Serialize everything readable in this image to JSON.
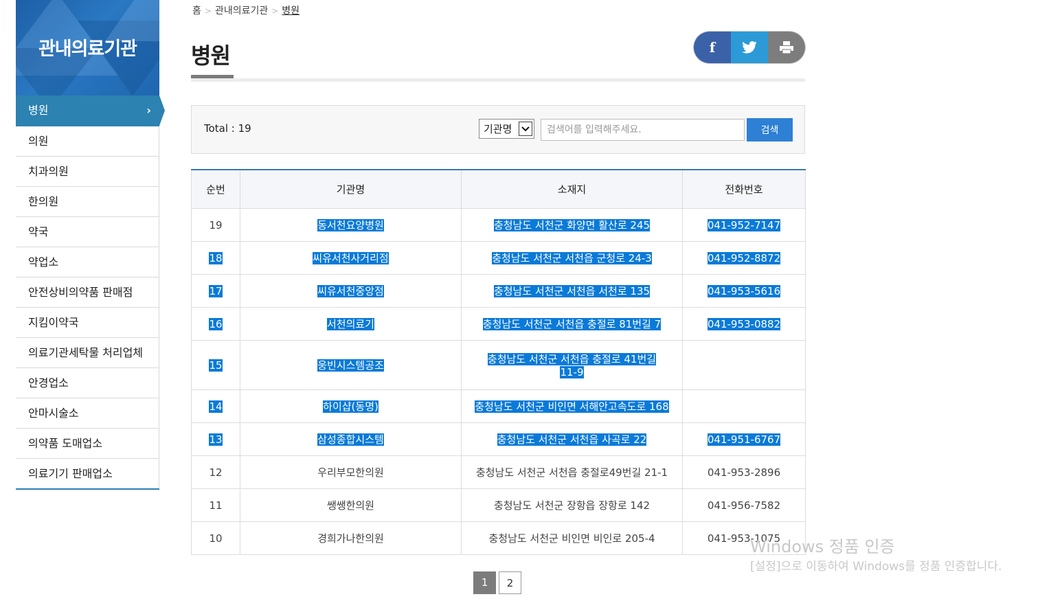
{
  "sidebar": {
    "title": "관내의료기관",
    "items": [
      {
        "label": "병원"
      },
      {
        "label": "의원"
      },
      {
        "label": "치과의원"
      },
      {
        "label": "한의원"
      },
      {
        "label": "약국"
      },
      {
        "label": "약업소"
      },
      {
        "label": "안전상비의약품 판매점"
      },
      {
        "label": "지킴이약국"
      },
      {
        "label": "의료기관세탁물 처리업체"
      },
      {
        "label": "안경업소"
      },
      {
        "label": "안마시술소"
      },
      {
        "label": "의약품 도매업소"
      },
      {
        "label": "의료기기 판매업소"
      }
    ],
    "active_chevron": "›"
  },
  "breadcrumb": {
    "home": "홈",
    "level1": "관내의료기관",
    "current": "병원"
  },
  "page": {
    "title": "병원"
  },
  "share": {
    "facebook": "f"
  },
  "search": {
    "total": "Total : 19",
    "select_value": "기관명",
    "placeholder": "검색어를 입력해주세요.",
    "button": "검색"
  },
  "table": {
    "headers": [
      "순번",
      "기관명",
      "소재지",
      "전화번호"
    ],
    "rows": [
      {
        "no": "19",
        "name": "동서천요양병원",
        "addr": "충청남도 서천군 화양면 활산로 245",
        "addr2": "",
        "tel": "041-952-7147"
      },
      {
        "no": "18",
        "name": "씨유서천사거리점",
        "addr": "충청남도 서천군 서천읍 군청로 24-3",
        "addr2": "",
        "tel": "041-952-8872"
      },
      {
        "no": "17",
        "name": "씨유서천중앙점",
        "addr": "충청남도 서천군 서천읍 서천로 135",
        "addr2": "",
        "tel": "041-953-5616"
      },
      {
        "no": "16",
        "name": "서천의료기",
        "addr": "충청남도 서천군 서천읍 충절로 81번길 7",
        "addr2": "",
        "tel": "041-953-0882"
      },
      {
        "no": "15",
        "name": "웅빈시스템공조",
        "addr": "충청남도 서천군 서천읍 충절로 41번길",
        "addr2": "11-9",
        "tel": ""
      },
      {
        "no": "14",
        "name": "하이샵(동명)",
        "addr": "충청남도 서천군 비인면 서해안고속도로 168",
        "addr2": "",
        "tel": ""
      },
      {
        "no": "13",
        "name": "삼성종합시스템",
        "addr": "충청남도 서천군 서천읍 사곡로 22",
        "addr2": "",
        "tel": "041-951-6767"
      },
      {
        "no": "12",
        "name": "우리부모한의원",
        "addr": "충청남도 서천군 서천읍 충절로49번길 21-1",
        "addr2": "",
        "tel": "041-953-2896"
      },
      {
        "no": "11",
        "name": "쌩쌩한의원",
        "addr": "충청남도 서천군 장항읍 장항로 142",
        "addr2": "",
        "tel": "041-956-7582"
      },
      {
        "no": "10",
        "name": "경희가나한의원",
        "addr": "충청남도 서천군 비인면 비인로 205-4",
        "addr2": "",
        "tel": "041-953-1075"
      }
    ]
  },
  "pagination": [
    "1",
    "2"
  ],
  "watermark": {
    "line1": "Windows 정품 인증",
    "line2": "[설정]으로 이동하여 Windows를 정품 인증합니다."
  },
  "colors": {
    "active_menu": "#2c82b0",
    "table_top": "#3a78b5",
    "search_button": "#2e80d4",
    "selection": "#0a7ad8"
  }
}
